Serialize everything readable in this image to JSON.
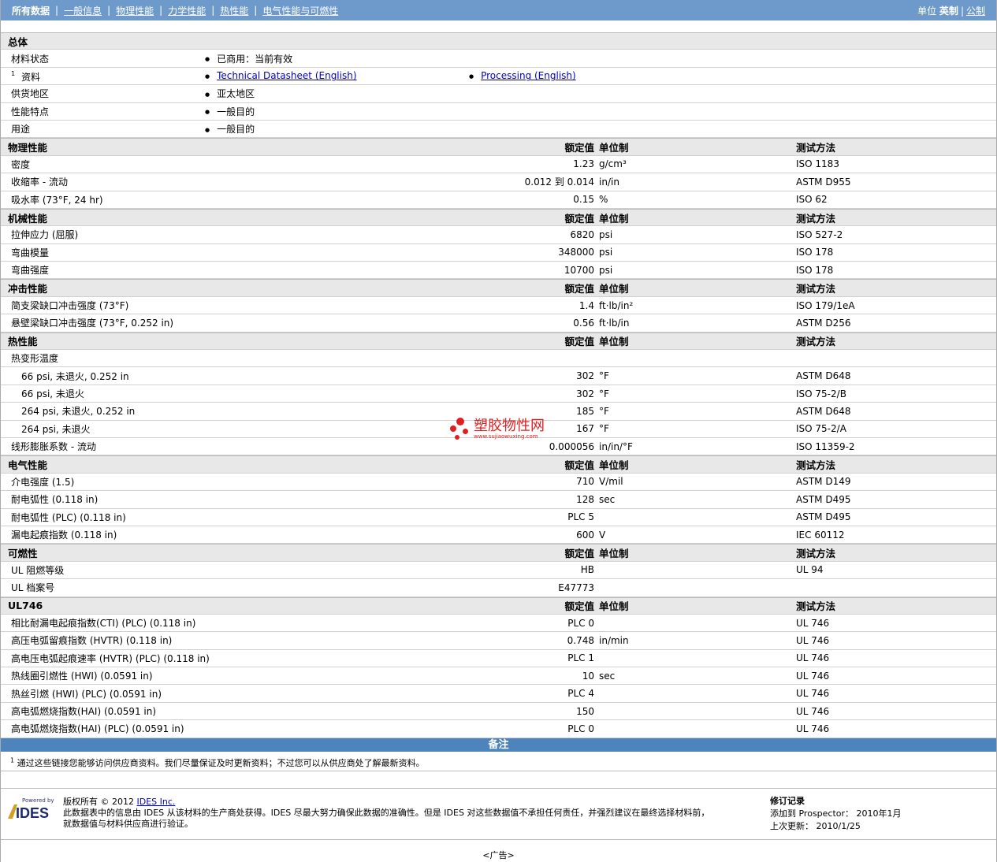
{
  "nav": {
    "items": [
      "所有数据",
      "一般信息",
      "物理性能",
      "力学性能",
      "热性能",
      "电气性能与可燃性"
    ],
    "unit_label": "单位",
    "unit_active": "英制",
    "unit_other": "公制"
  },
  "columns": {
    "nominal": "额定值",
    "unit": "单位制",
    "test": "测试方法"
  },
  "general": {
    "title": "总体",
    "rows": [
      {
        "label": "材料状态",
        "value": "已商用：当前有效"
      },
      {
        "label": "资料",
        "sup": "1",
        "link1": "Technical Datasheet (English)",
        "link2": "Processing (English)"
      },
      {
        "label": "供货地区",
        "value": "亚太地区"
      },
      {
        "label": "性能特点",
        "value": "一般目的"
      },
      {
        "label": "用途",
        "value": "一般目的"
      }
    ]
  },
  "sections": [
    {
      "title": "物理性能",
      "rows": [
        {
          "label": "密度",
          "value": "1.23",
          "unit": "g/cm³",
          "test": "ISO 1183"
        },
        {
          "label": "收缩率 - 流动",
          "value": "0.012 到  0.014",
          "unit": "in/in",
          "test": "ASTM D955"
        },
        {
          "label": "吸水率 (73°F, 24 hr)",
          "value": "0.15",
          "unit": "%",
          "test": "ISO 62"
        }
      ]
    },
    {
      "title": "机械性能",
      "rows": [
        {
          "label": "拉伸应力 (屈服)",
          "value": "6820",
          "unit": "psi",
          "test": "ISO 527-2"
        },
        {
          "label": "弯曲模量",
          "value": "348000",
          "unit": "psi",
          "test": "ISO 178"
        },
        {
          "label": "弯曲强度",
          "value": "10700",
          "unit": "psi",
          "test": "ISO 178"
        }
      ]
    },
    {
      "title": "冲击性能",
      "rows": [
        {
          "label": "简支梁缺口冲击强度 (73°F)",
          "value": "1.4",
          "unit": "ft·lb/in²",
          "test": "ISO 179/1eA"
        },
        {
          "label": "悬壁梁缺口冲击强度 (73°F, 0.252 in)",
          "value": "0.56",
          "unit": "ft·lb/in",
          "test": "ASTM D256"
        }
      ]
    },
    {
      "title": "热性能",
      "rows": [
        {
          "label": "热变形温度",
          "value": "",
          "unit": "",
          "test": ""
        },
        {
          "label": "66 psi, 未退火, 0.252 in",
          "indent": true,
          "value": "302",
          "unit": "°F",
          "test": "ASTM D648"
        },
        {
          "label": "66 psi, 未退火",
          "indent": true,
          "value": "302",
          "unit": "°F",
          "test": "ISO 75-2/B"
        },
        {
          "label": "264 psi, 未退火, 0.252 in",
          "indent": true,
          "value": "185",
          "unit": "°F",
          "test": "ASTM D648"
        },
        {
          "label": "264 psi, 未退火",
          "indent": true,
          "value": "167",
          "unit": "°F",
          "test": "ISO 75-2/A"
        },
        {
          "label": "线形膨胀系数 - 流动",
          "value": "0.000056",
          "unit": "in/in/°F",
          "test": "ISO 11359-2"
        }
      ]
    },
    {
      "title": "电气性能",
      "rows": [
        {
          "label": "介电强度 (1.5)",
          "value": "710",
          "unit": "V/mil",
          "test": "ASTM D149"
        },
        {
          "label": "耐电弧性 (0.118 in)",
          "value": "128",
          "unit": "sec",
          "test": "ASTM D495"
        },
        {
          "label": "耐电弧性 (PLC) (0.118 in)",
          "value": "PLC 5",
          "unit": "",
          "test": "ASTM D495"
        },
        {
          "label": "漏电起痕指数 (0.118 in)",
          "value": "600",
          "unit": "V",
          "test": "IEC 60112"
        }
      ]
    },
    {
      "title": "可燃性",
      "rows": [
        {
          "label": "UL 阻燃等级",
          "value": "HB",
          "unit": "",
          "test": "UL 94"
        },
        {
          "label": "UL 档案号",
          "value": "E47773",
          "unit": "",
          "test": ""
        }
      ]
    },
    {
      "title": "UL746",
      "rows": [
        {
          "label": "相比耐漏电起痕指数(CTI) (PLC) (0.118 in)",
          "value": "PLC 0",
          "unit": "",
          "test": "UL 746"
        },
        {
          "label": "高压电弧留痕指数 (HVTR) (0.118 in)",
          "value": "0.748",
          "unit": "in/min",
          "test": "UL 746"
        },
        {
          "label": "高电压电弧起痕速率 (HVTR) (PLC) (0.118 in)",
          "value": "PLC 1",
          "unit": "",
          "test": "UL 746"
        },
        {
          "label": "热线圈引燃性 (HWI) (0.0591 in)",
          "value": "10",
          "unit": "sec",
          "test": "UL 746"
        },
        {
          "label": "热丝引燃 (HWI) (PLC) (0.0591 in)",
          "value": "PLC 4",
          "unit": "",
          "test": "UL 746"
        },
        {
          "label": "高电弧燃烧指数(HAI) (0.0591 in)",
          "value": "150",
          "unit": "",
          "test": "UL 746"
        },
        {
          "label": "高电弧燃烧指数(HAI) (PLC) (0.0591 in)",
          "value": "PLC 0",
          "unit": "",
          "test": "UL 746"
        }
      ]
    }
  ],
  "notes": {
    "title": "备注",
    "sup": "1",
    "text": "通过这些链接您能够访问供应商资料。我们尽量保证及时更新资料；不过您可以从供应商处了解最新资料。"
  },
  "footer": {
    "logo_text": "Powered by IDES",
    "copyright": "版权所有 © 2012",
    "company_link": "IDES Inc.",
    "disclaimer1": "此数据表中的信息由 IDES 从该材料的生产商处获得。IDES 尽最大努力确保此数据的准确性。但是 IDES 对这些数据值不承担任何责任，并强烈建议在最终选择材料前，",
    "disclaimer2": "就数据值与材料供应商进行验证。",
    "rev_title": "修订记录",
    "rev_added": "添加到 Prospector： 2010年1月",
    "rev_updated": "上次更新： 2010/1/25"
  },
  "ad": "<广告>",
  "watermark": {
    "name": "塑胶物性网",
    "url": "www.sujiaowuxing.com"
  }
}
